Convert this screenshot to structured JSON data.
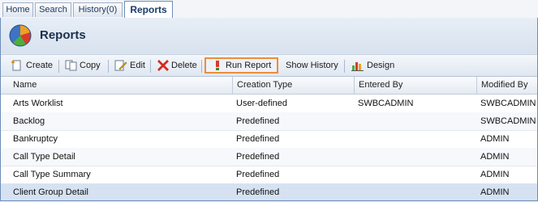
{
  "tabs": [
    {
      "label": "Home"
    },
    {
      "label": "Search"
    },
    {
      "label": "History(0)"
    },
    {
      "label": "Reports",
      "active": true
    }
  ],
  "page": {
    "title": "Reports"
  },
  "toolbar": {
    "create": "Create",
    "copy": "Copy",
    "edit": "Edit",
    "delete": "Delete",
    "run_report": "Run Report",
    "show_history": "Show History",
    "design": "Design"
  },
  "table": {
    "columns": [
      "Name",
      "Creation Type",
      "Entered By",
      "Modified By"
    ],
    "rows": [
      {
        "name": "Arts Worklist",
        "creation_type": "User-defined",
        "entered_by": "SWBCADMIN",
        "modified_by": "SWBCADMIN"
      },
      {
        "name": "Backlog",
        "creation_type": "Predefined",
        "entered_by": "",
        "modified_by": "SWBCADMIN"
      },
      {
        "name": "Bankruptcy",
        "creation_type": "Predefined",
        "entered_by": "",
        "modified_by": "ADMIN"
      },
      {
        "name": "Call Type Detail",
        "creation_type": "Predefined",
        "entered_by": "",
        "modified_by": "ADMIN"
      },
      {
        "name": "Call Type Summary",
        "creation_type": "Predefined",
        "entered_by": "",
        "modified_by": "ADMIN"
      },
      {
        "name": "Client Group Detail",
        "creation_type": "Predefined",
        "entered_by": "",
        "modified_by": "ADMIN"
      }
    ]
  },
  "colors": {
    "highlight": "#ee8d3a",
    "tab_border": "#6d8db8",
    "selected_row": "#d6e2f2"
  }
}
